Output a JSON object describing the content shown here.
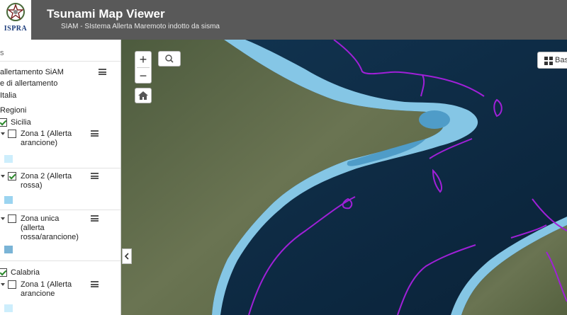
{
  "header": {
    "logo_text": "ISPRA",
    "title": "Tsunami Map Viewer",
    "subtitle": "SIAM - SIstema Allerta Maremoto indotto da sisma"
  },
  "sidebar": {
    "top_fragment": "s",
    "layer_group_title": "allertamento SiAM",
    "sublayer_label": "e di allertamento",
    "italia_label": "Italia",
    "regioni_label": "Regioni",
    "regions": [
      {
        "name": "Sicilia",
        "checked": true,
        "zones": [
          {
            "label_lines": [
              "Zona 1 (Allerta",
              "arancione)"
            ],
            "checked": false,
            "swatch_color": "#cdeefc"
          },
          {
            "label_lines": [
              "Zona 2 (Allerta",
              "rossa)"
            ],
            "checked": true,
            "swatch_color": "#9bd4f0"
          },
          {
            "label_lines": [
              "Zona unica",
              "(allerta",
              "rossa/arancione)"
            ],
            "checked": false,
            "swatch_color": "#7ab4d6"
          }
        ]
      },
      {
        "name": "Calabria",
        "checked": true,
        "zones": [
          {
            "label_lines": [
              "Zona 1 (Allerta",
              "arancione"
            ],
            "checked": false,
            "swatch_color": "#cdeefc"
          }
        ]
      }
    ]
  },
  "map_controls": {
    "zoom_in": "+",
    "zoom_out": "−",
    "basemap_label": "Bas",
    "search_icon": "search-icon",
    "home_icon": "home-icon",
    "collapse_icon": "chevron-left-icon"
  },
  "colors": {
    "header_bg": "#595959",
    "sea": "#0d2a44",
    "land": "#5c6b48",
    "zone_light": "#8ccfee",
    "zone_dark": "#4f9cc8",
    "boundary_line": "#a020d8"
  }
}
